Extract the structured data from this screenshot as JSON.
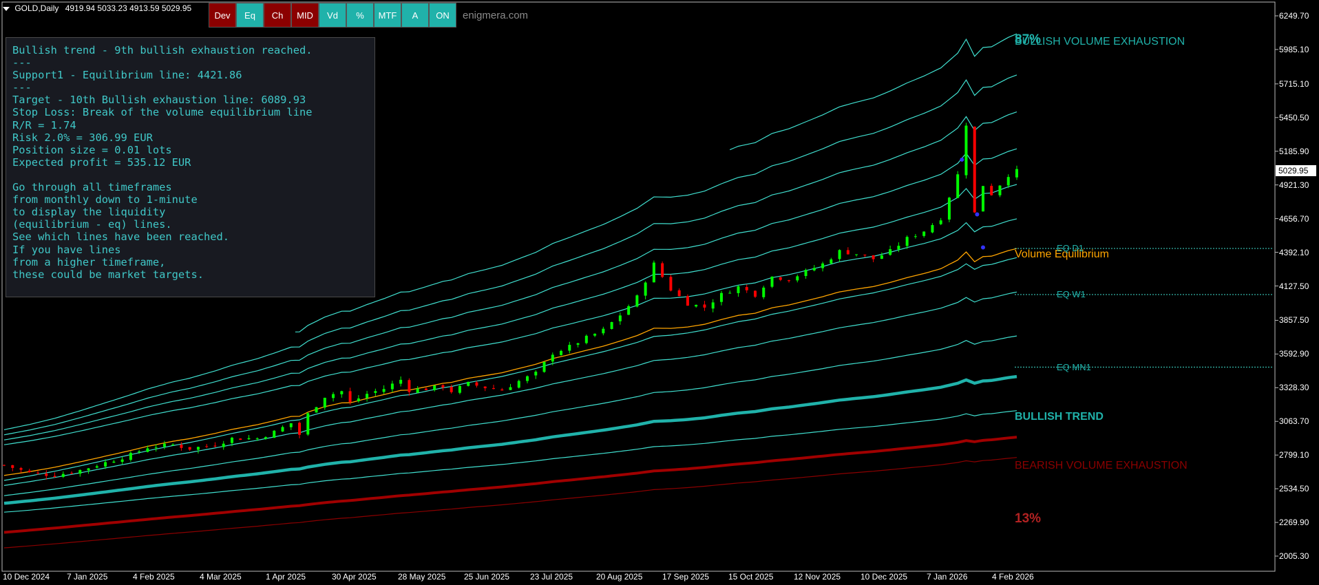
{
  "header": {
    "symbol": "GOLD,Daily",
    "ohlc": "4919.94 5033.23 4913.59 5029.95"
  },
  "toolbar": {
    "buttons": [
      {
        "label": "Dev",
        "style": "red",
        "w": 40
      },
      {
        "label": "Eq",
        "style": "teal",
        "w": 40
      },
      {
        "label": "Ch",
        "style": "red",
        "w": 40
      },
      {
        "label": "MID",
        "style": "red",
        "w": 40
      },
      {
        "label": "Vd",
        "style": "teal",
        "w": 40
      },
      {
        "label": "%",
        "style": "teal",
        "w": 40
      },
      {
        "label": "MTF",
        "style": "teal",
        "w": 40
      },
      {
        "label": "A",
        "style": "teal",
        "w": 40
      },
      {
        "label": "ON",
        "style": "teal",
        "w": 40
      }
    ],
    "site": "enigmera.com"
  },
  "infobox": {
    "lines": [
      "Bullish trend - 9th bullish exhaustion reached.",
      "---",
      "Support1 - Equilibrium line: 4421.86",
      "---",
      "Target - 10th Bullish exhaustion line: 6089.93",
      "Stop Loss: Break of the volume equilibrium line",
      "R/R = 1.74",
      "Risk 2.0% = 306.99 EUR",
      "Position size = 0.01 lots",
      "Expected profit = 535.12 EUR",
      "",
      "Go through all timeframes",
      "from monthly down to 1-minute",
      "to display the liquidity",
      "(equilibrium - eq) lines.",
      "See which lines have been reached.",
      "If you have lines",
      "from a higher timeframe,",
      "these could be market targets."
    ]
  },
  "annotations": {
    "pct_top": "87%",
    "bullish_exhaustion": "BULLISH VOLUME EXHAUSTION",
    "volume_equilibrium": "Volume Equilibrium",
    "eq_d1": "EQ D1",
    "eq_w1": "EQ W1",
    "eq_mn1": "EQ MN1",
    "bullish_trend": "BULLISH TREND",
    "bearish_exhaustion": "BEARISH VOLUME EXHAUSTION",
    "pct_bottom": "13%"
  },
  "colors": {
    "bull": "#00ff00",
    "bear": "#ff0000",
    "band": "#40e0d0",
    "trend": "#20b2aa",
    "equilibrium": "#ffa500",
    "bearish": "#8b0000",
    "marker": "#3333ff"
  },
  "chart_data": {
    "type": "candlestick",
    "current_price": "5029.95",
    "y_ticks": [
      "6249.70",
      "5985.10",
      "5715.10",
      "5450.50",
      "5185.90",
      "4921.30",
      "4656.70",
      "4392.10",
      "4127.50",
      "3857.50",
      "3592.90",
      "3328.30",
      "3063.70",
      "2799.10",
      "2534.50",
      "2269.90",
      "2005.30"
    ],
    "ylim": [
      2005.3,
      6249.7
    ],
    "x_ticks": [
      "10 Dec 2024",
      "7 Jan 2025",
      "4 Feb 2025",
      "4 Mar 2025",
      "1 Apr 2025",
      "30 Apr 2025",
      "28 May 2025",
      "25 Jun 2025",
      "23 Jul 2025",
      "20 Aug 2025",
      "17 Sep 2025",
      "15 Oct 2025",
      "12 Nov 2025",
      "10 Dec 2025",
      "7 Jan 2026",
      "4 Feb 2026"
    ],
    "eq_levels": {
      "EQ D1": 4421.86,
      "EQ W1": 4060,
      "EQ MN1": 3490
    },
    "close_path": [
      [
        0,
        2720
      ],
      [
        3,
        2660
      ],
      [
        6,
        2640
      ],
      [
        9,
        2680
      ],
      [
        12,
        2740
      ],
      [
        15,
        2800
      ],
      [
        17,
        2860
      ],
      [
        20,
        2880
      ],
      [
        22,
        2850
      ],
      [
        25,
        2880
      ],
      [
        27,
        2930
      ],
      [
        30,
        2930
      ],
      [
        32,
        2980
      ],
      [
        34,
        3050
      ],
      [
        35,
        2960
      ],
      [
        36,
        3120
      ],
      [
        38,
        3260
      ],
      [
        40,
        3300
      ],
      [
        41,
        3210
      ],
      [
        43,
        3280
      ],
      [
        45,
        3320
      ],
      [
        47,
        3390
      ],
      [
        48,
        3310
      ],
      [
        50,
        3320
      ],
      [
        52,
        3340
      ],
      [
        53,
        3300
      ],
      [
        55,
        3360
      ],
      [
        57,
        3330
      ],
      [
        59,
        3310
      ],
      [
        61,
        3380
      ],
      [
        63,
        3440
      ],
      [
        65,
        3600
      ],
      [
        67,
        3650
      ],
      [
        69,
        3720
      ],
      [
        71,
        3780
      ],
      [
        73,
        3900
      ],
      [
        75,
        4040
      ],
      [
        77,
        4300
      ],
      [
        79,
        4100
      ],
      [
        81,
        3990
      ],
      [
        83,
        3960
      ],
      [
        85,
        4060
      ],
      [
        87,
        4120
      ],
      [
        89,
        4060
      ],
      [
        91,
        4200
      ],
      [
        93,
        4180
      ],
      [
        95,
        4240
      ],
      [
        97,
        4300
      ],
      [
        99,
        4400
      ],
      [
        101,
        4380
      ],
      [
        103,
        4340
      ],
      [
        105,
        4400
      ],
      [
        107,
        4500
      ],
      [
        109,
        4560
      ],
      [
        111,
        4660
      ],
      [
        113,
        5000
      ],
      [
        114,
        5400
      ],
      [
        115,
        4700
      ],
      [
        116,
        4920
      ],
      [
        117,
        4850
      ],
      [
        119,
        5000
      ],
      [
        120,
        5029.95
      ]
    ],
    "bands": [
      {
        "kind": "upper",
        "name": "BULLISH VOLUME EXHAUSTION",
        "start": [
          0,
          3117
        ],
        "end": [
          120,
          6108
        ],
        "mid_shift": 0.0
      },
      {
        "kind": "upper",
        "start": [
          0,
          3058
        ],
        "end": [
          120,
          5785
        ]
      },
      {
        "kind": "upper",
        "start": [
          0,
          2998
        ],
        "end": [
          120,
          5495
        ]
      },
      {
        "kind": "upper",
        "start": [
          0,
          2958
        ],
        "end": [
          120,
          5205
        ]
      },
      {
        "kind": "upper",
        "start": [
          0,
          2918
        ],
        "end": [
          120,
          4925
        ]
      },
      {
        "kind": "upper",
        "start": [
          0,
          2880
        ],
        "end": [
          120,
          4655
        ]
      },
      {
        "kind": "equilibrium",
        "name": "Volume Equilibrium",
        "start": [
          0,
          2639
        ],
        "end": [
          120,
          4421.86
        ]
      },
      {
        "kind": "lower",
        "start": [
          0,
          2600
        ],
        "end": [
          120,
          4350
        ]
      },
      {
        "kind": "lower",
        "start": [
          0,
          2560
        ],
        "end": [
          120,
          4080
        ]
      },
      {
        "kind": "lower",
        "start": [
          0,
          2480
        ],
        "end": [
          120,
          3735
        ]
      },
      {
        "kind": "trend",
        "name": "BULLISH TREND",
        "start": [
          0,
          2420
        ],
        "end": [
          120,
          3416
        ]
      },
      {
        "kind": "lower",
        "start": [
          0,
          2350
        ],
        "end": [
          120,
          3148
        ]
      },
      {
        "kind": "bearish_thick",
        "start": [
          0,
          2192
        ],
        "end": [
          120,
          2940
        ]
      },
      {
        "kind": "bearish",
        "name": "BEARISH VOLUME EXHAUSTION",
        "start": [
          0,
          2070
        ],
        "end": [
          120,
          2780
        ]
      }
    ]
  }
}
